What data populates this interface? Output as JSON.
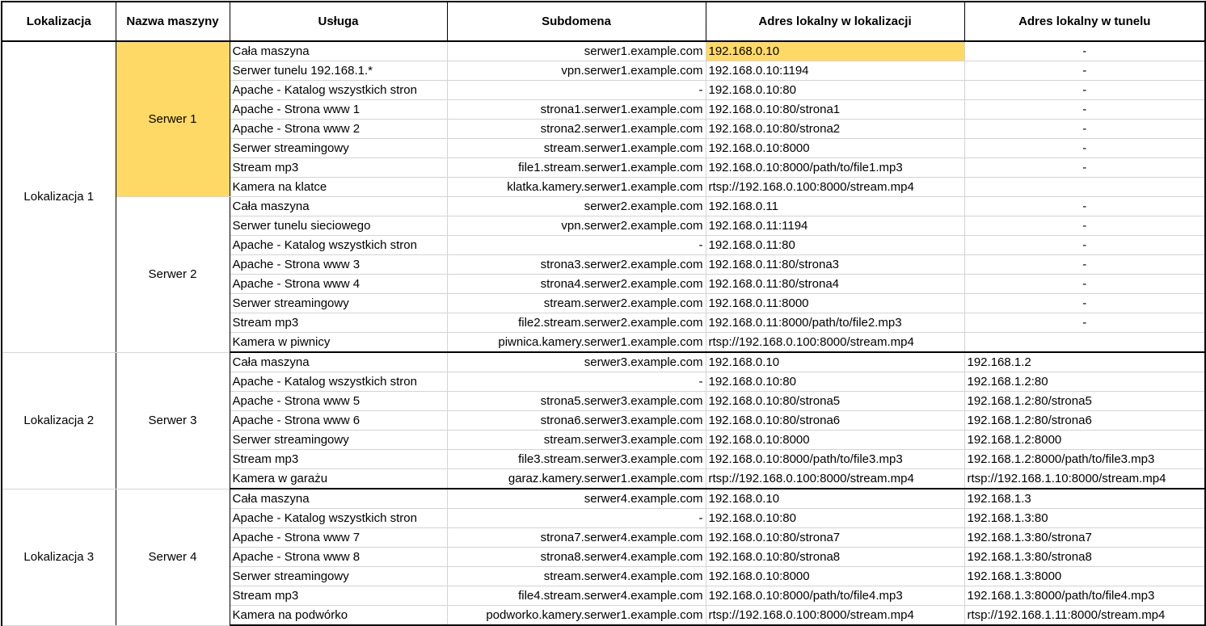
{
  "headers": [
    "Lokalizacja",
    "Nazwa maszyny",
    "Usługa",
    "Subdomena",
    "Adres lokalny w lokalizacji",
    "Adres lokalny w tunelu"
  ],
  "colors": {
    "highlight": "#ffd966",
    "grid": "#d4d4d4",
    "border": "#000000"
  },
  "locations": [
    {
      "name": "Lokalizacja 1",
      "machines": [
        {
          "name": "Serwer 1",
          "highlight": true,
          "rows": [
            {
              "service": "Cała maszyna",
              "subdomain": "serwer1.example.com",
              "local": "192.168.0.10",
              "tunnel": "-",
              "local_highlight": true
            },
            {
              "service": "Serwer tunelu 192.168.1.*",
              "subdomain": "vpn.serwer1.example.com",
              "local": "192.168.0.10:1194",
              "tunnel": "-"
            },
            {
              "service": "Apache - Katalog wszystkich stron",
              "subdomain": "-",
              "local": "192.168.0.10:80",
              "tunnel": "-"
            },
            {
              "service": "Apache - Strona www 1",
              "subdomain": "strona1.serwer1.example.com",
              "local": "192.168.0.10:80/strona1",
              "tunnel": "-"
            },
            {
              "service": "Apache - Strona www 2",
              "subdomain": "strona2.serwer1.example.com",
              "local": "192.168.0.10:80/strona2",
              "tunnel": "-"
            },
            {
              "service": "Serwer streamingowy",
              "subdomain": "stream.serwer1.example.com",
              "local": "192.168.0.10:8000",
              "tunnel": "-"
            },
            {
              "service": "Stream mp3",
              "subdomain": "file1.stream.serwer1.example.com",
              "local": "192.168.0.10:8000/path/to/file1.mp3",
              "tunnel": "-"
            },
            {
              "service": "Kamera na klatce",
              "subdomain": "klatka.kamery.serwer1.example.com",
              "local": "rtsp://192.168.0.100:8000/stream.mp4",
              "tunnel": ""
            }
          ]
        },
        {
          "name": "Serwer 2",
          "rows": [
            {
              "service": "Cała maszyna",
              "subdomain": "serwer2.example.com",
              "local": "192.168.0.11",
              "tunnel": "-"
            },
            {
              "service": "Serwer tunelu sieciowego",
              "subdomain": "vpn.serwer2.example.com",
              "local": "192.168.0.11:1194",
              "tunnel": "-"
            },
            {
              "service": "Apache - Katalog wszystkich stron",
              "subdomain": "-",
              "local": "192.168.0.11:80",
              "tunnel": "-"
            },
            {
              "service": "Apache - Strona www 3",
              "subdomain": "strona3.serwer2.example.com",
              "local": "192.168.0.11:80/strona3",
              "tunnel": "-"
            },
            {
              "service": "Apache - Strona www 4",
              "subdomain": "strona4.serwer2.example.com",
              "local": "192.168.0.11:80/strona4",
              "tunnel": "-"
            },
            {
              "service": "Serwer streamingowy",
              "subdomain": "stream.serwer2.example.com",
              "local": "192.168.0.11:8000",
              "tunnel": "-"
            },
            {
              "service": "Stream mp3",
              "subdomain": "file2.stream.serwer2.example.com",
              "local": "192.168.0.11:8000/path/to/file2.mp3",
              "tunnel": "-"
            },
            {
              "service": "Kamera w piwnicy",
              "subdomain": "piwnica.kamery.serwer1.example.com",
              "local": "rtsp://192.168.0.100:8000/stream.mp4",
              "tunnel": ""
            }
          ]
        }
      ]
    },
    {
      "name": "Lokalizacja 2",
      "machines": [
        {
          "name": "Serwer 3",
          "rows": [
            {
              "service": "Cała maszyna",
              "subdomain": "serwer3.example.com",
              "local": "192.168.0.10",
              "tunnel": "192.168.1.2"
            },
            {
              "service": "Apache - Katalog wszystkich stron",
              "subdomain": "-",
              "local": "192.168.0.10:80",
              "tunnel": "192.168.1.2:80"
            },
            {
              "service": "Apache - Strona www 5",
              "subdomain": "strona5.serwer3.example.com",
              "local": "192.168.0.10:80/strona5",
              "tunnel": "192.168.1.2:80/strona5"
            },
            {
              "service": "Apache - Strona www 6",
              "subdomain": "strona6.serwer3.example.com",
              "local": "192.168.0.10:80/strona6",
              "tunnel": "192.168.1.2:80/strona6"
            },
            {
              "service": "Serwer streamingowy",
              "subdomain": "stream.serwer3.example.com",
              "local": "192.168.0.10:8000",
              "tunnel": "192.168.1.2:8000"
            },
            {
              "service": "Stream mp3",
              "subdomain": "file3.stream.serwer3.example.com",
              "local": "192.168.0.10:8000/path/to/file3.mp3",
              "tunnel": "192.168.1.2:8000/path/to/file3.mp3"
            },
            {
              "service": "Kamera w garażu",
              "subdomain": "garaz.kamery.serwer1.example.com",
              "local": "rtsp://192.168.0.100:8000/stream.mp4",
              "tunnel": "rtsp://192.168.1.10:8000/stream.mp4"
            }
          ]
        }
      ]
    },
    {
      "name": "Lokalizacja 3",
      "machines": [
        {
          "name": "Serwer 4",
          "rows": [
            {
              "service": "Cała maszyna",
              "subdomain": "serwer4.example.com",
              "local": "192.168.0.10",
              "tunnel": "192.168.1.3"
            },
            {
              "service": "Apache - Katalog wszystkich stron",
              "subdomain": "-",
              "local": "192.168.0.10:80",
              "tunnel": "192.168.1.3:80"
            },
            {
              "service": "Apache - Strona www 7",
              "subdomain": "strona7.serwer4.example.com",
              "local": "192.168.0.10:80/strona7",
              "tunnel": "192.168.1.3:80/strona7"
            },
            {
              "service": "Apache - Strona www 8",
              "subdomain": "strona8.serwer4.example.com",
              "local": "192.168.0.10:80/strona8",
              "tunnel": "192.168.1.3:80/strona8"
            },
            {
              "service": "Serwer streamingowy",
              "subdomain": "stream.serwer4.example.com",
              "local": "192.168.0.10:8000",
              "tunnel": "192.168.1.3:8000"
            },
            {
              "service": "Stream mp3",
              "subdomain": "file4.stream.serwer4.example.com",
              "local": "192.168.0.10:8000/path/to/file4.mp3",
              "tunnel": "192.168.1.3:8000/path/to/file4.mp3"
            },
            {
              "service": "Kamera na podwórko",
              "subdomain": "podworko.kamery.serwer1.example.com",
              "local": "rtsp://192.168.0.100:8000/stream.mp4",
              "tunnel": "rtsp://192.168.1.11:8000/stream.mp4"
            }
          ]
        }
      ]
    }
  ]
}
